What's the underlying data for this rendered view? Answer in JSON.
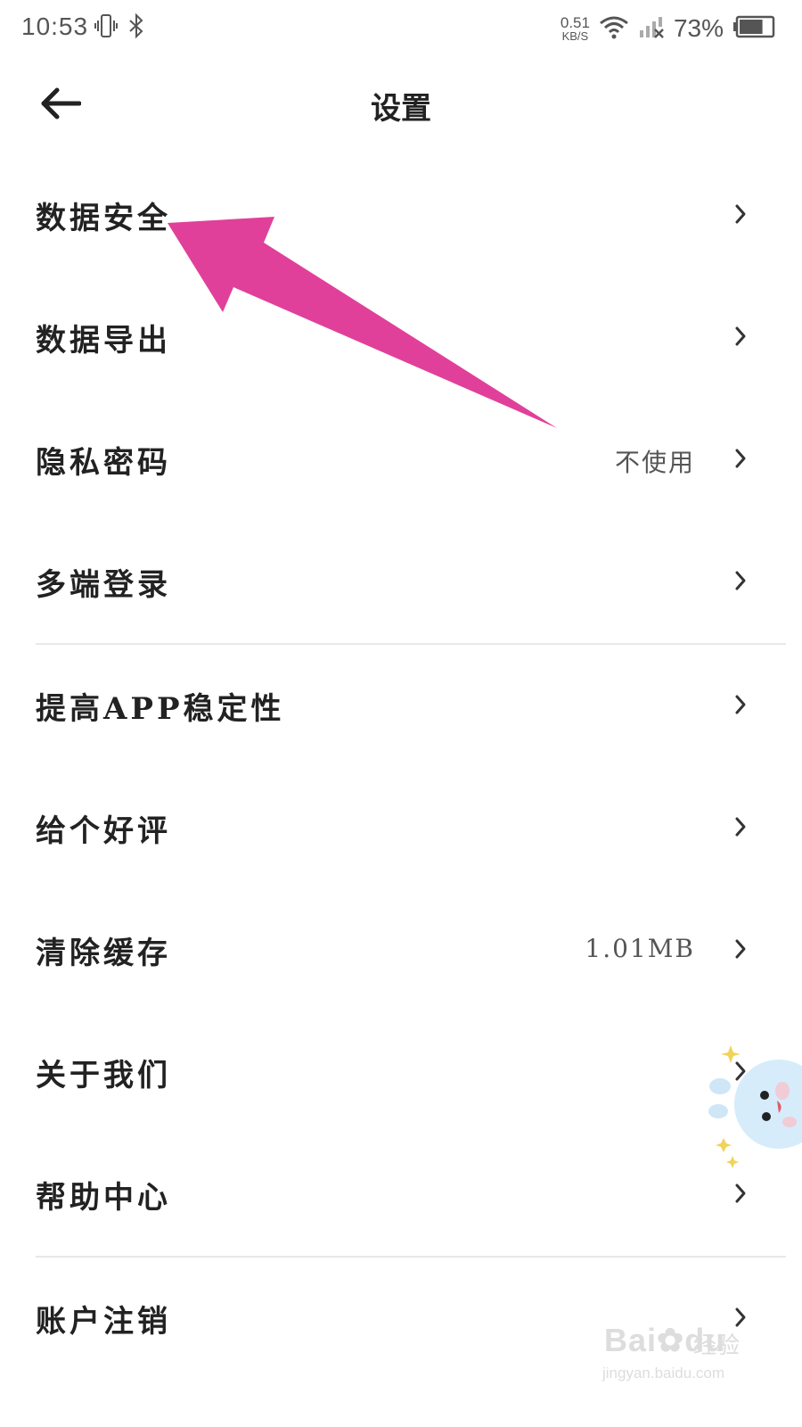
{
  "status_bar": {
    "time": "10:53",
    "net_speed_value": "0.51",
    "net_speed_unit": "KB/S",
    "battery_percent": "73%",
    "battery_level": 0.73,
    "icons": [
      "vibrate-icon",
      "bluetooth-icon",
      "wifi-icon",
      "signal-no-sim-icon",
      "battery-icon"
    ]
  },
  "header": {
    "title": "设置",
    "back_icon": "arrow-left-icon"
  },
  "menu": {
    "items": [
      {
        "label": "数据安全",
        "value": ""
      },
      {
        "label": "数据导出",
        "value": ""
      },
      {
        "label": "隐私密码",
        "value": "不使用"
      },
      {
        "label": "多端登录",
        "value": ""
      },
      {
        "label": "提高APP稳定性",
        "value": ""
      },
      {
        "label": "给个好评",
        "value": ""
      },
      {
        "label": "清除缓存",
        "value": "1.01MB"
      },
      {
        "label": "关于我们",
        "value": ""
      },
      {
        "label": "帮助中心",
        "value": ""
      },
      {
        "label": "账户注销",
        "value": ""
      }
    ],
    "chevron_icon": "chevron-right-icon"
  },
  "annotation": {
    "arrow_color": "#e0409a"
  },
  "watermark": {
    "brand": "Bai",
    "brand_suffix": "du",
    "cn": "经验",
    "url": "jingyan.baidu.com"
  },
  "colors": {
    "text_primary": "#222222",
    "text_secondary": "#555555",
    "divider": "#e8e8e8",
    "background": "#ffffff"
  }
}
